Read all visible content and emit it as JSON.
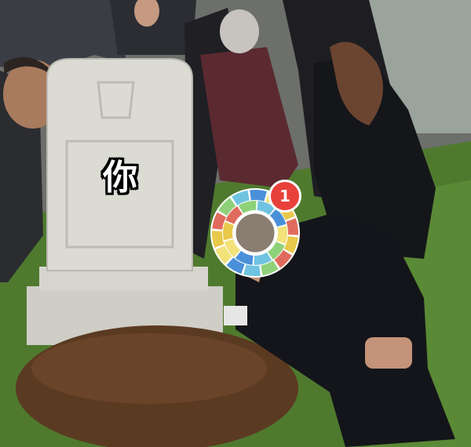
{
  "meme": {
    "tombstone_text": "你",
    "notification_count": "1"
  },
  "colors": {
    "grass": "#4f7a2e",
    "dirt": "#5b3a22",
    "tombstone": "#d9d8d0",
    "badge": "#e8413b",
    "ring_colors": [
      "#e9c94a",
      "#e06b5c",
      "#8fd17a",
      "#6fc3e0",
      "#4a90d9",
      "#f2e27a"
    ]
  },
  "icons": {
    "avatar": "app-ring-logo-icon"
  }
}
